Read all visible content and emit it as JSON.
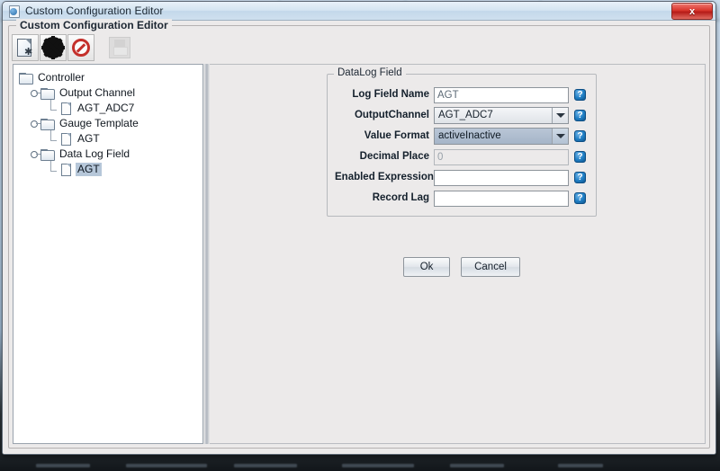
{
  "window": {
    "title": "Custom Configuration Editor",
    "icon": "app-icon",
    "close_label": "x"
  },
  "panel": {
    "title": "Custom Configuration Editor"
  },
  "toolbar": {
    "buttons": [
      {
        "name": "new-file-button",
        "tooltip": "New",
        "icon": "new-file-icon",
        "enabled": true
      },
      {
        "name": "settings-button",
        "tooltip": "Gear",
        "icon": "gear-icon",
        "enabled": true
      },
      {
        "name": "delete-button",
        "tooltip": "Delete",
        "icon": "delete-icon",
        "enabled": true
      },
      {
        "name": "save-button",
        "tooltip": "Save",
        "icon": "save-icon",
        "enabled": false
      }
    ]
  },
  "tree": {
    "nodes": [
      {
        "label": "Controller",
        "depth": 1,
        "type": "folder",
        "expanded": true,
        "selected": false
      },
      {
        "label": "Output Channel",
        "depth": 2,
        "type": "folder",
        "expanded": true,
        "selected": false
      },
      {
        "label": "AGT_ADC7",
        "depth": 3,
        "type": "leaf",
        "expanded": false,
        "selected": false
      },
      {
        "label": "Gauge Template",
        "depth": 2,
        "type": "folder",
        "expanded": true,
        "selected": false
      },
      {
        "label": "AGT",
        "depth": 3,
        "type": "leaf",
        "expanded": false,
        "selected": false
      },
      {
        "label": "Data Log Field",
        "depth": 2,
        "type": "folder",
        "expanded": true,
        "selected": false
      },
      {
        "label": "AGT",
        "depth": 3,
        "type": "leaf",
        "expanded": false,
        "selected": true
      }
    ]
  },
  "form": {
    "group_title": "DataLog Field",
    "help_glyph": "?",
    "fields": [
      {
        "name": "log-field-name",
        "label": "Log Field Name",
        "control": "text",
        "value": "AGT",
        "placeholder": "",
        "disabled": false
      },
      {
        "name": "output-channel",
        "label": "OutputChannel",
        "control": "combo",
        "value": "AGT_ADC7",
        "placeholder": "",
        "disabled": false,
        "focused": false
      },
      {
        "name": "value-format",
        "label": "Value Format",
        "control": "combo",
        "value": "activeInactive",
        "placeholder": "",
        "disabled": false,
        "focused": true
      },
      {
        "name": "decimal-place",
        "label": "Decimal Place",
        "control": "text",
        "value": "0",
        "placeholder": "",
        "disabled": true
      },
      {
        "name": "enabled-expression",
        "label": "Enabled Expression",
        "control": "text",
        "value": "",
        "placeholder": "",
        "disabled": false
      },
      {
        "name": "record-lag",
        "label": "Record Lag",
        "control": "text",
        "value": "",
        "placeholder": "",
        "disabled": false
      }
    ],
    "ok_label": "Ok",
    "cancel_label": "Cancel"
  },
  "colors": {
    "accent": "#1f7ec4",
    "selection": "#b6c7d9",
    "combo_focus": "#a5b5c8",
    "close_red": "#d8352c",
    "window_bg": "#eceaea"
  }
}
